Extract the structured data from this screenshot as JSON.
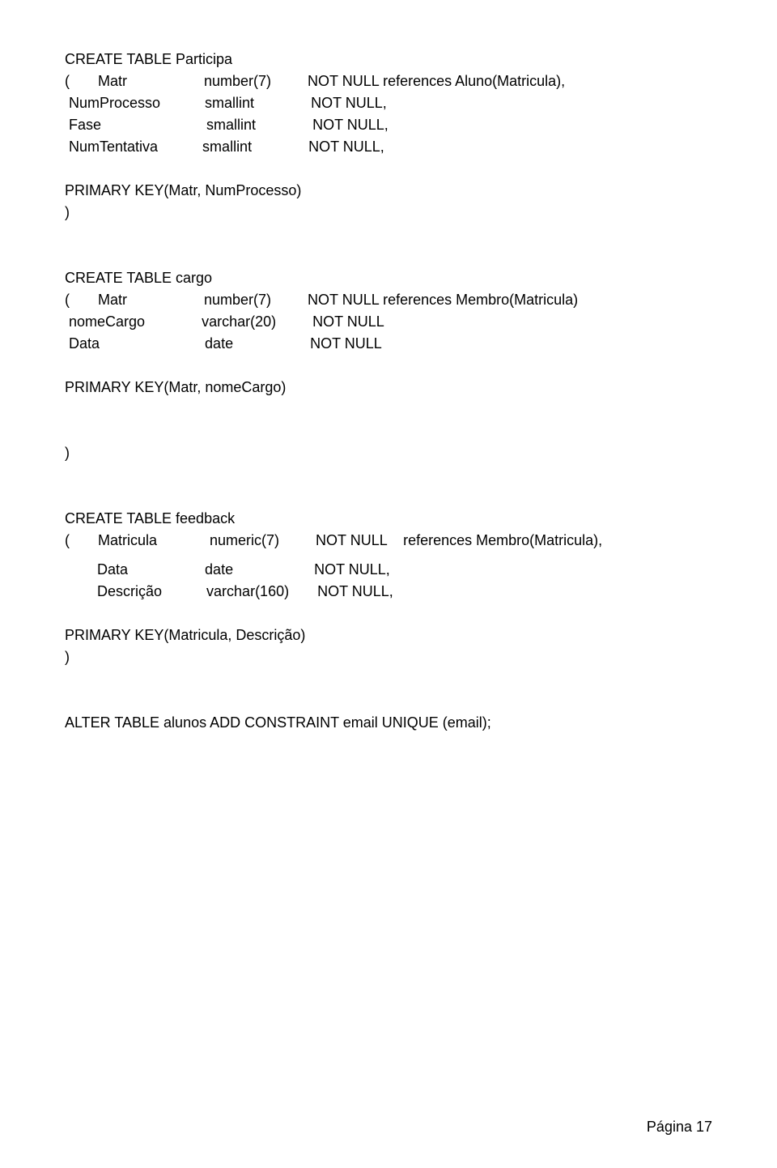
{
  "block1": {
    "l1": "CREATE TABLE Participa",
    "l2": "(       Matr                   number(7)         NOT NULL references Aluno(Matricula),",
    "l3": " NumProcesso           smallint              NOT NULL,",
    "l4": " Fase                          smallint              NOT NULL,",
    "l5": " NumTentativa           smallint              NOT NULL,"
  },
  "block1pk": "PRIMARY KEY(Matr, NumProcesso)",
  "block1close": ")",
  "block2": {
    "l1": "CREATE TABLE cargo",
    "l2": "(       Matr                   number(7)         NOT NULL references Membro(Matricula)",
    "l3": " nomeCargo              varchar(20)         NOT NULL",
    "l4": " Data                          date                   NOT NULL"
  },
  "block2pk": "PRIMARY KEY(Matr, nomeCargo)",
  "block2close": ")",
  "block3": {
    "l1": "CREATE TABLE feedback",
    "l2": "(       Matricula             numeric(7)         NOT NULL    references Membro(Matricula),",
    "l3": "        Data                   date                    NOT NULL,",
    "l4": "        Descrição           varchar(160)       NOT NULL,"
  },
  "block3pk": "PRIMARY KEY(Matricula, Descrição)",
  "block3close": ")",
  "alter": "ALTER TABLE alunos ADD CONSTRAINT email UNIQUE (email);",
  "footer": "Página 17"
}
